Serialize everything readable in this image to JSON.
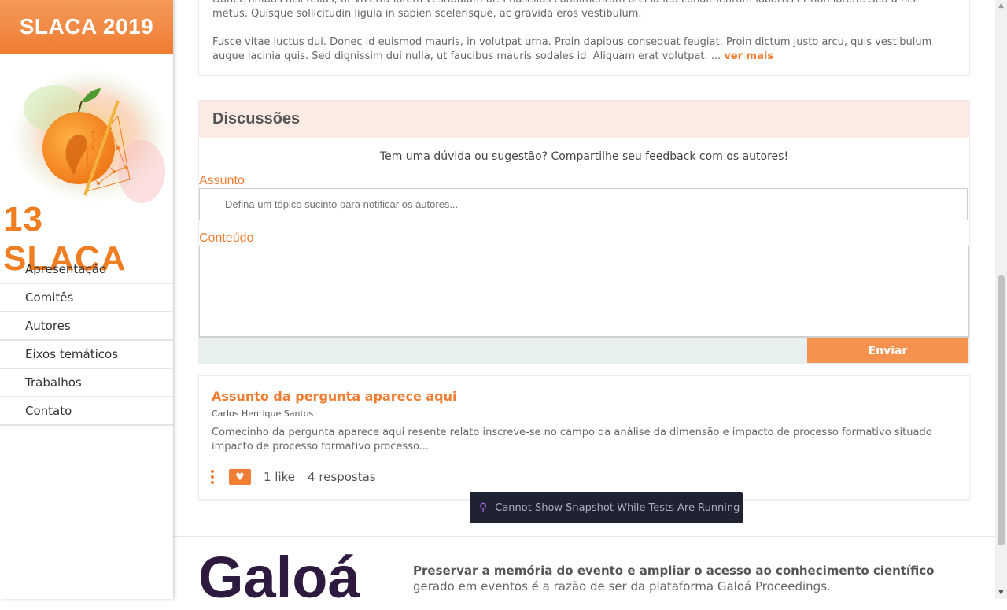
{
  "sidebar": {
    "event_title": "SLACA 2019",
    "logo_text": "13 SLACA",
    "nav": [
      {
        "label": "Apresentação"
      },
      {
        "label": "Comitês"
      },
      {
        "label": "Autores"
      },
      {
        "label": "Eixos temáticos"
      },
      {
        "label": "Trabalhos"
      },
      {
        "label": "Contato"
      }
    ]
  },
  "abstract": {
    "para1_partial": "Donec finibus nisl tellus, ut viverra lorem vestibulum ut. Phasellus condimentum orci ia leo condimentum lobortis et non lorem. Sed a nisi metus. Quisque sollicitudin ligula in sapien scelerisque, ac gravida eros vestibulum.",
    "para2": "Fusce vitae luctus dui. Donec id euismod mauris, in volutpat urna. Proin dapibus consequat feugiat. Proin dictum justo arcu, quis vestibulum augue lacinia quis. Sed dignissim dui nulla, ut faucibus mauris sodales id. Aliquam erat volutpat. ...",
    "more_label": "ver mais"
  },
  "discussion": {
    "heading": "Discussões",
    "prompt": "Tem uma dúvida ou sugestão? Compartilhe seu feedback com os autores!",
    "subject_label": "Assunto",
    "subject_placeholder": "Defina um tópico sucinto para notificar os autores...",
    "content_label": "Conteúdo",
    "content_value": "",
    "send_label": "Enviar"
  },
  "question": {
    "title": "Assunto da pergunta aparece aqui",
    "author": "Carlos Henrique Santos",
    "body": "Comecinho da pergunta aparece aqui resente relato inscreve-se no campo da análise da dimensão e impacto de processo formativo situado impacto de processo formativo processo...",
    "likes": "1 like",
    "replies": "4 respostas"
  },
  "toast": {
    "text": "Cannot Show Snapshot While Tests Are Running"
  },
  "footer": {
    "brand": "Galoá",
    "tagline_bold": "Preservar a memória do evento e ampliar o acesso ao conhecimento científico",
    "tagline_rest": " gerado em eventos é a razão de ser da plataforma Galoá Proceedings."
  },
  "colors": {
    "accent": "#ef7d33",
    "discussion_header_bg": "#fbebe2",
    "toast_bg": "#1f2231",
    "brand_dark": "#2f1a3f"
  },
  "icons": [
    "heart-icon",
    "more-vertical-icon",
    "pin-icon",
    "scroll-up-arrow-icon",
    "scroll-down-arrow-icon"
  ]
}
